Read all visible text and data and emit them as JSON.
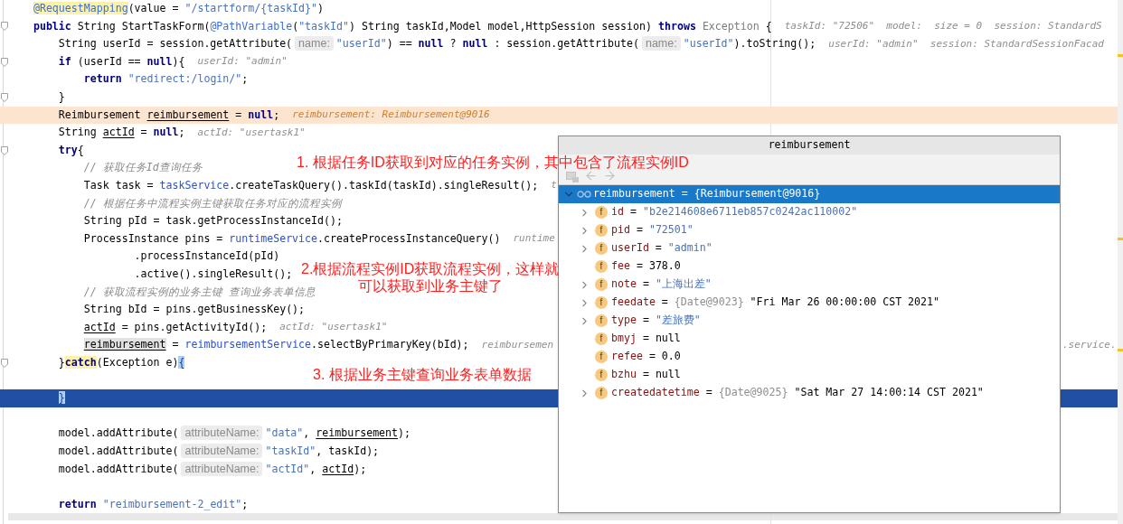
{
  "editor": {
    "lines": [
      {
        "fold": false,
        "current": false,
        "selected": false,
        "tokens": [
          {
            "kind": "annotation_hl",
            "text": "    @RequestMapping"
          },
          {
            "kind": "plain",
            "text": "(value = "
          },
          {
            "kind": "string",
            "text": "\"/startform/{taskId}\""
          },
          {
            "kind": "plain",
            "text": ")"
          }
        ]
      },
      {
        "fold": true,
        "current": false,
        "selected": false,
        "tokens": [
          {
            "kind": "keyword",
            "text": "    public"
          },
          {
            "kind": "plain",
            "text": " String StartTaskForm("
          },
          {
            "kind": "annotation",
            "text": "@PathVariable"
          },
          {
            "kind": "plain",
            "text": "("
          },
          {
            "kind": "string",
            "text": "\"taskId\""
          },
          {
            "kind": "plain",
            "text": ") String taskId,Model model,HttpSession session) "
          },
          {
            "kind": "keyword",
            "text": "throws"
          },
          {
            "kind": "muted",
            "text": " Exception"
          },
          {
            "kind": "plain",
            "text": " {"
          }
        ],
        "debug": "taskId: \"72506\"  model:  size = 0  session: StandardS"
      },
      {
        "fold": false,
        "current": false,
        "selected": false,
        "tokens": [
          {
            "kind": "plain",
            "text": "        String userId = session.getAttribute("
          },
          {
            "kind": "hint",
            "text": "name:"
          },
          {
            "kind": "string",
            "text": "\"userId\""
          },
          {
            "kind": "plain",
            "text": ") == "
          },
          {
            "kind": "keyword",
            "text": "null"
          },
          {
            "kind": "plain",
            "text": " ? "
          },
          {
            "kind": "keyword",
            "text": "null"
          },
          {
            "kind": "plain",
            "text": " : session.getAttribute("
          },
          {
            "kind": "hint",
            "text": "name:"
          },
          {
            "kind": "string",
            "text": "\"userId\""
          },
          {
            "kind": "plain",
            "text": ").toString();"
          }
        ],
        "debug": "userId: \"admin\"  session: StandardSessionFacad"
      },
      {
        "fold": true,
        "current": false,
        "selected": false,
        "tokens": [
          {
            "kind": "keyword",
            "text": "        if"
          },
          {
            "kind": "plain",
            "text": " (userId == "
          },
          {
            "kind": "keyword",
            "text": "null"
          },
          {
            "kind": "plain",
            "text": "){"
          }
        ],
        "debug": "userId: \"admin\""
      },
      {
        "fold": false,
        "current": false,
        "selected": false,
        "tokens": [
          {
            "kind": "keyword",
            "text": "            return"
          },
          {
            "kind": "string",
            "text": " \"redirect:/login/\""
          },
          {
            "kind": "plain",
            "text": ";"
          }
        ]
      },
      {
        "fold": true,
        "current": false,
        "selected": false,
        "tokens": [
          {
            "kind": "plain",
            "text": "        }"
          }
        ]
      },
      {
        "fold": false,
        "current": true,
        "selected": false,
        "tokens": [
          {
            "kind": "plain",
            "text": "        Reimbursement "
          },
          {
            "kind": "underline",
            "text": "reimbursement"
          },
          {
            "kind": "plain",
            "text": " = "
          },
          {
            "kind": "keyword",
            "text": "null"
          },
          {
            "kind": "plain",
            "text": ";"
          }
        ],
        "debug": "reimbursement: Reimbursement@9016"
      },
      {
        "fold": false,
        "current": false,
        "selected": false,
        "tokens": [
          {
            "kind": "plain",
            "text": "        String "
          },
          {
            "kind": "underline",
            "text": "actId"
          },
          {
            "kind": "plain",
            "text": " = "
          },
          {
            "kind": "keyword",
            "text": "null"
          },
          {
            "kind": "plain",
            "text": ";"
          }
        ],
        "debug": "actId: \"usertask1\""
      },
      {
        "fold": true,
        "current": false,
        "selected": false,
        "tokens": [
          {
            "kind": "keyword",
            "text": "        try"
          },
          {
            "kind": "plain",
            "text": "{"
          }
        ]
      },
      {
        "fold": false,
        "current": false,
        "selected": false,
        "tokens": [
          {
            "kind": "comment",
            "text": "            // 获取任务Id查询任务"
          }
        ]
      },
      {
        "fold": false,
        "current": false,
        "selected": false,
        "tokens": [
          {
            "kind": "plain",
            "text": "            Task task = "
          },
          {
            "kind": "field",
            "text": "taskService"
          },
          {
            "kind": "plain",
            "text": ".createTaskQuery().taskId(taskId).singleResult();"
          }
        ],
        "debug": "t"
      },
      {
        "fold": false,
        "current": false,
        "selected": false,
        "tokens": [
          {
            "kind": "comment",
            "text": "            // 根据任务中流程实例主键获取任务对应的流程实例"
          }
        ]
      },
      {
        "fold": false,
        "current": false,
        "selected": false,
        "tokens": [
          {
            "kind": "plain",
            "text": "            String pId = task.getProcessInstanceId();"
          }
        ]
      },
      {
        "fold": false,
        "current": false,
        "selected": false,
        "tokens": [
          {
            "kind": "plain",
            "text": "            ProcessInstance pins = "
          },
          {
            "kind": "field",
            "text": "runtimeService"
          },
          {
            "kind": "plain",
            "text": ".createProcessInstanceQuery()"
          }
        ],
        "debug": "runtime"
      },
      {
        "fold": false,
        "current": false,
        "selected": false,
        "tokens": [
          {
            "kind": "plain",
            "text": "                    .processInstanceId(pId)"
          }
        ]
      },
      {
        "fold": false,
        "current": false,
        "selected": false,
        "tokens": [
          {
            "kind": "plain",
            "text": "                    .active().singleResult();"
          }
        ]
      },
      {
        "fold": false,
        "current": false,
        "selected": false,
        "tokens": [
          {
            "kind": "comment",
            "text": "            // 获取流程实例的业务主键 查询业务表单信息"
          }
        ]
      },
      {
        "fold": false,
        "current": false,
        "selected": false,
        "tokens": [
          {
            "kind": "plain",
            "text": "            String bId = pins.getBusinessKey();"
          }
        ]
      },
      {
        "fold": false,
        "current": false,
        "selected": false,
        "tokens": [
          {
            "kind": "underline",
            "text": "            actId"
          },
          {
            "kind": "plain",
            "text": " = pins.getActivityId();"
          }
        ],
        "debug": "actId: \"usertask1\""
      },
      {
        "fold": false,
        "current": false,
        "selected": false,
        "tokens": [
          {
            "kind": "underline_hl",
            "text": "            reimbursement"
          },
          {
            "kind": "plain",
            "text": " = "
          },
          {
            "kind": "field",
            "text": "reimbursementService"
          },
          {
            "kind": "plain",
            "text": ".selectByPrimaryKey(bId);"
          }
        ],
        "debug": "reimbursemen",
        "debug_tail": ".service."
      },
      {
        "fold": true,
        "current": false,
        "selected": false,
        "tokens": [
          {
            "kind": "plain",
            "text": "        }"
          },
          {
            "kind": "keyword_hl",
            "text": "catch"
          },
          {
            "kind": "plain",
            "text": "(Exception e)"
          },
          {
            "kind": "brace_hl",
            "text": "{"
          }
        ]
      },
      {
        "fold": false,
        "current": false,
        "selected": false
      },
      {
        "fold": false,
        "current": false,
        "selected": true,
        "tokens": [
          {
            "kind": "brace_hl",
            "text": "        }"
          }
        ]
      },
      {
        "fold": false,
        "current": false,
        "selected": false
      },
      {
        "fold": false,
        "current": false,
        "selected": false,
        "tokens": [
          {
            "kind": "plain",
            "text": "        model.addAttribute("
          },
          {
            "kind": "hint",
            "text": "attributeName:"
          },
          {
            "kind": "string",
            "text": "\"data\""
          },
          {
            "kind": "plain",
            "text": ", "
          },
          {
            "kind": "underline",
            "text": "reimbursement"
          },
          {
            "kind": "plain",
            "text": ");"
          }
        ]
      },
      {
        "fold": false,
        "current": false,
        "selected": false,
        "tokens": [
          {
            "kind": "plain",
            "text": "        model.addAttribute("
          },
          {
            "kind": "hint",
            "text": "attributeName:"
          },
          {
            "kind": "string",
            "text": "\"taskId\""
          },
          {
            "kind": "plain",
            "text": ", taskId);"
          }
        ]
      },
      {
        "fold": false,
        "current": false,
        "selected": false,
        "tokens": [
          {
            "kind": "plain",
            "text": "        model.addAttribute("
          },
          {
            "kind": "hint",
            "text": "attributeName:"
          },
          {
            "kind": "string",
            "text": "\"actId\""
          },
          {
            "kind": "plain",
            "text": ", "
          },
          {
            "kind": "underline",
            "text": "actId"
          },
          {
            "kind": "plain",
            "text": ");"
          }
        ]
      },
      {
        "fold": false,
        "current": false,
        "selected": false
      },
      {
        "fold": false,
        "current": false,
        "selected": false,
        "tokens": [
          {
            "kind": "keyword",
            "text": "        return"
          },
          {
            "kind": "string",
            "text": " \"reimbursement-2_edit\""
          },
          {
            "kind": "plain",
            "text": ";"
          }
        ]
      }
    ]
  },
  "annotations": [
    {
      "lines": [
        "1. 根据任务ID获取到对应的任务实例，其中包含了流程实例ID"
      ]
    },
    {
      "lines": [
        "2.根据流程实例ID获取流程实例，这样就",
        "可以获取到业务主键了"
      ]
    },
    {
      "lines": [
        "3. 根据业务主键查询业务表单数据"
      ]
    }
  ],
  "popup": {
    "title": "reimbursement",
    "tree": {
      "text": "reimbursement = {Reimbursement@9016}",
      "expanded": true,
      "selected": true,
      "children": [
        {
          "icon": "f",
          "name": "id",
          "eq": "=",
          "value": "\"b2e214608e6711eb857c0242ac110002\"",
          "kind": "string",
          "expandable": true,
          "selected": false
        },
        {
          "icon": "f",
          "name": "pid",
          "eq": "=",
          "value": "\"72501\"",
          "kind": "string",
          "expandable": true,
          "selected": false
        },
        {
          "icon": "f",
          "name": "userId",
          "eq": "=",
          "value": "\"admin\"",
          "kind": "string",
          "expandable": true,
          "selected": false
        },
        {
          "icon": "f",
          "name": "fee",
          "eq": "=",
          "value": "378.0",
          "kind": "plain",
          "expandable": false,
          "selected": false
        },
        {
          "icon": "f",
          "name": "note",
          "eq": "=",
          "value": "\"上海出差\"",
          "kind": "string",
          "expandable": true,
          "selected": false
        },
        {
          "icon": "f",
          "name": "feedate",
          "eq": "=",
          "ref": "{Date@9023}",
          "value": "\"Fri Mar 26 00:00:00 CST 2021\"",
          "kind": "plain",
          "expandable": true,
          "selected": false
        },
        {
          "icon": "f",
          "name": "type",
          "eq": "=",
          "value": "\"差旅费\"",
          "kind": "string",
          "expandable": true,
          "selected": false
        },
        {
          "icon": "f",
          "name": "bmyj",
          "eq": "=",
          "value": "null",
          "kind": "plain",
          "expandable": false,
          "selected": false
        },
        {
          "icon": "f",
          "name": "refee",
          "eq": "=",
          "value": "0.0",
          "kind": "plain",
          "expandable": false,
          "selected": false
        },
        {
          "icon": "f",
          "name": "bzhu",
          "eq": "=",
          "value": "null",
          "kind": "plain",
          "expandable": false,
          "selected": false
        },
        {
          "icon": "f",
          "name": "createdatetime",
          "eq": "=",
          "ref": "{Date@9025}",
          "value": "\"Sat Mar 27 14:00:14 CST 2021\"",
          "kind": "plain",
          "expandable": true,
          "selected": false
        }
      ]
    }
  }
}
